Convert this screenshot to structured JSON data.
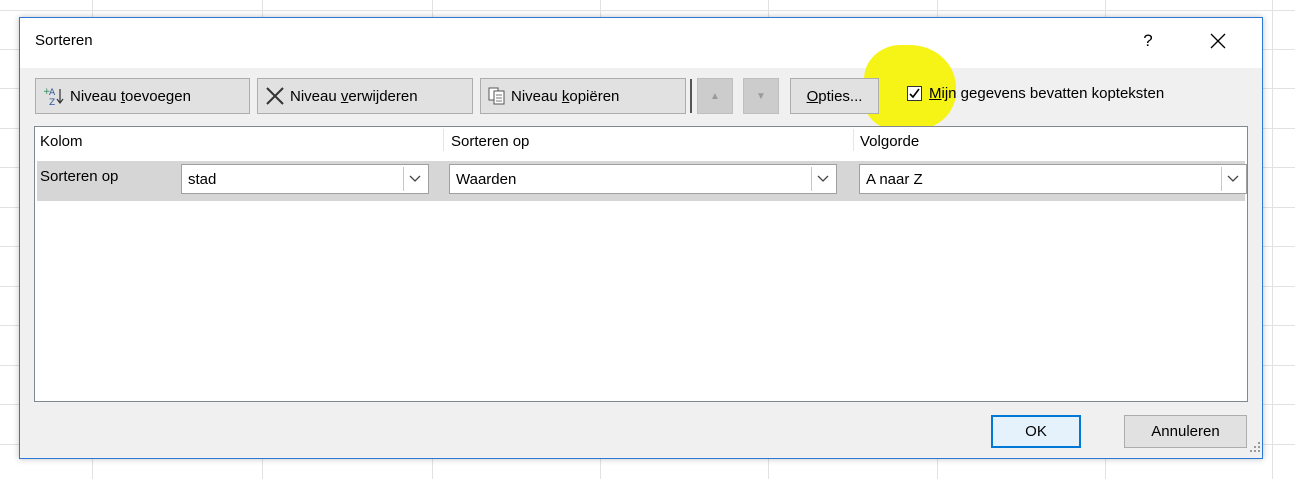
{
  "dialog": {
    "title": "Sorteren",
    "help_label": "?",
    "close_label": "×"
  },
  "toolbar": {
    "add_level": {
      "pre": "Niveau ",
      "key": "t",
      "post": "oevoegen"
    },
    "delete_level": {
      "pre": "Niveau ",
      "key": "v",
      "post": "erwijderen"
    },
    "copy_level": {
      "pre": "Niveau ",
      "key": "k",
      "post": "opiëren"
    },
    "move_up_label": "▲",
    "move_down_label": "▼",
    "options": {
      "pre": "",
      "key": "O",
      "post": "pties..."
    },
    "headers_checkbox": {
      "checked": true,
      "pre": "",
      "key": "M",
      "post": "ijn gegevens bevatten kopteksten"
    }
  },
  "list": {
    "headers": [
      "Kolom",
      "Sorteren op",
      "Volgorde"
    ],
    "rows": [
      {
        "label": "Sorteren op",
        "column": "stad",
        "sort_on": "Waarden",
        "order": "A naar Z"
      }
    ]
  },
  "buttons": {
    "ok": "OK",
    "cancel": "Annuleren"
  },
  "colors": {
    "highlight": "#f5f20a",
    "accent": "#0078d7"
  }
}
